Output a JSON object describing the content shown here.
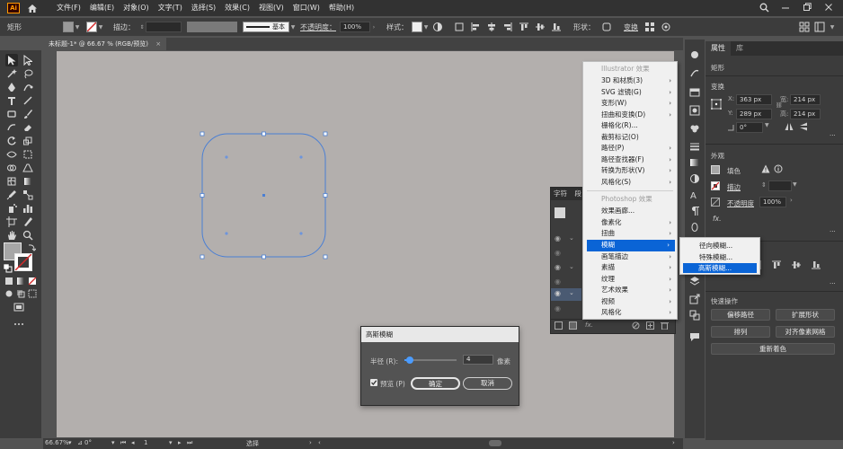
{
  "app": {
    "logo": "Ai"
  },
  "menu_bar": {
    "items": [
      "文件(F)",
      "编辑(E)",
      "对象(O)",
      "文字(T)",
      "选择(S)",
      "效果(C)",
      "视图(V)",
      "窗口(W)",
      "帮助(H)"
    ]
  },
  "control_bar": {
    "selection_label": "矩形",
    "stroke_label": "描边：",
    "stroke_style": "基本",
    "opacity_label": "不透明度：",
    "opacity_value": "100%",
    "style_label": "样式：",
    "shape_label": "形状：",
    "transform_label": "变换"
  },
  "document_tab": {
    "title": "未标题-1* @ 66.67 % (RGB/预览)",
    "close": "×"
  },
  "status_bar": {
    "zoom": "66.67%",
    "rotation": "0°",
    "artboard": "1",
    "tool": "选择"
  },
  "properties_panel": {
    "tabs": [
      "属性",
      "库"
    ],
    "object_type": "矩形",
    "transform_title": "变换",
    "x_label": "X:",
    "x_value": "363 px",
    "y_label": "Y:",
    "y_value": "289 px",
    "w_label": "宽:",
    "w_value": "214 px",
    "h_label": "高:",
    "h_value": "214 px",
    "angle_value": "0°",
    "appearance_title": "外观",
    "fill_label": "填色",
    "stroke_label": "描边",
    "opacity_label": "不透明度",
    "opacity_value": "100%",
    "fx_label": "fx.",
    "quick_actions_title": "快速操作",
    "buttons": [
      "偏移路径",
      "扩展形状",
      "排列",
      "对齐像素网格",
      "重新着色"
    ]
  },
  "character_panel": {
    "tabs": [
      "字符",
      "段"
    ]
  },
  "effect_menu": {
    "illustrator_header": "Illustrator 效果",
    "illustrator_items": [
      {
        "label": "3D 和材质(3)",
        "submenu": true
      },
      {
        "label": "SVG 滤镜(G)",
        "submenu": true
      },
      {
        "label": "变形(W)",
        "submenu": true
      },
      {
        "label": "扭曲和变换(D)",
        "submenu": true
      },
      {
        "label": "栅格化(R)...",
        "submenu": false
      },
      {
        "label": "裁剪标记(O)",
        "submenu": false
      },
      {
        "label": "路径(P)",
        "submenu": true
      },
      {
        "label": "路径查找器(F)",
        "submenu": true
      },
      {
        "label": "转换为形状(V)",
        "submenu": true
      },
      {
        "label": "风格化(S)",
        "submenu": true
      }
    ],
    "photoshop_header": "Photoshop 效果",
    "photoshop_items": [
      {
        "label": "效果画廊...",
        "submenu": false
      },
      {
        "label": "像素化",
        "submenu": true
      },
      {
        "label": "扭曲",
        "submenu": true
      },
      {
        "label": "模糊",
        "submenu": true,
        "highlighted": true
      },
      {
        "label": "画笔描边",
        "submenu": true
      },
      {
        "label": "素描",
        "submenu": true
      },
      {
        "label": "纹理",
        "submenu": true
      },
      {
        "label": "艺术效果",
        "submenu": true
      },
      {
        "label": "视频",
        "submenu": true
      },
      {
        "label": "风格化",
        "submenu": true
      }
    ],
    "arrow": "›"
  },
  "blur_submenu": {
    "items": [
      "径向模糊...",
      "特殊模糊...",
      "高斯模糊..."
    ],
    "highlighted_index": 2
  },
  "blur_dialog": {
    "title": "高斯模糊",
    "radius_label": "半径 (R):",
    "radius_value": "4",
    "unit": "像素",
    "slider_fraction": 0.11,
    "preview_label": "预览 (P)",
    "preview_checked": true,
    "ok": "确定",
    "cancel": "取消"
  },
  "colors": {
    "accent": "#0a64d6",
    "path_stroke": "#4a7fd4",
    "artboard": "#b3afad",
    "stroke_swatch": "#d42a2a"
  }
}
